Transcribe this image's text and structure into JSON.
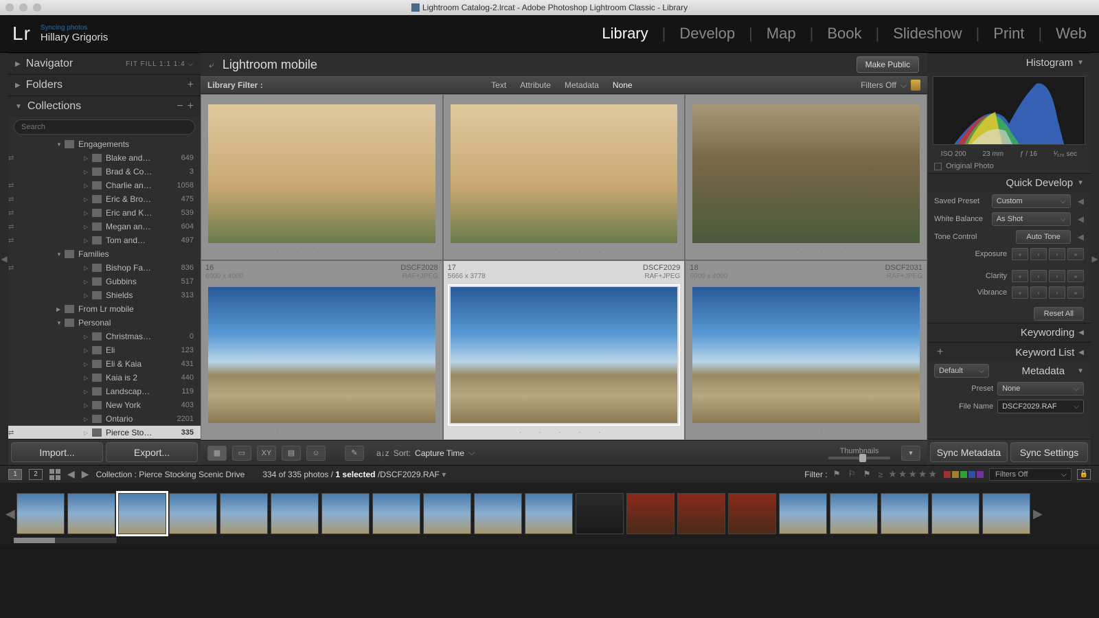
{
  "titlebar": {
    "text": "Lightroom Catalog-2.lrcat - Adobe Photoshop Lightroom Classic - Library"
  },
  "identity": {
    "sync": "Syncing photos",
    "user": "Hillary Grigoris"
  },
  "modules": {
    "library": "Library",
    "develop": "Develop",
    "map": "Map",
    "book": "Book",
    "slideshow": "Slideshow",
    "print": "Print",
    "web": "Web"
  },
  "left": {
    "navigator": {
      "title": "Navigator",
      "modes": "FIT   FILL   1:1   1:4 ⌵"
    },
    "folders": {
      "title": "Folders"
    },
    "collections": {
      "title": "Collections",
      "search_placeholder": "Search"
    },
    "groups": {
      "engagements": "Engagements",
      "families": "Families",
      "fromlr": "From Lr mobile",
      "personal": "Personal"
    },
    "items_eng": [
      {
        "label": "Blake and…",
        "count": "649"
      },
      {
        "label": "Brad & Co…",
        "count": "3"
      },
      {
        "label": "Charlie an…",
        "count": "1058"
      },
      {
        "label": "Eric & Bro…",
        "count": "475"
      },
      {
        "label": "Eric and K…",
        "count": "539"
      },
      {
        "label": "Megan an…",
        "count": "604"
      },
      {
        "label": "Tom and…",
        "count": "497"
      }
    ],
    "items_fam": [
      {
        "label": "Bishop Fa…",
        "count": "836"
      },
      {
        "label": "Gubbins",
        "count": "517"
      },
      {
        "label": "Shields",
        "count": "313"
      }
    ],
    "items_pers": [
      {
        "label": "Christmas…",
        "count": "0"
      },
      {
        "label": "Eli",
        "count": "123"
      },
      {
        "label": "Eli & Kaia",
        "count": "431"
      },
      {
        "label": "Kaia is 2",
        "count": "440"
      },
      {
        "label": "Landscap…",
        "count": "119"
      },
      {
        "label": "New York",
        "count": "403"
      },
      {
        "label": "Ontario",
        "count": "2201"
      },
      {
        "label": "Pierce Sto…",
        "count": "335"
      }
    ],
    "import_btn": "Import...",
    "export_btn": "Export..."
  },
  "center": {
    "breadcrumb": "Lightroom mobile",
    "make_public": "Make Public",
    "filter_label": "Library Filter :",
    "filter_tabs": {
      "text": "Text",
      "attribute": "Attribute",
      "metadata": "Metadata",
      "none": "None"
    },
    "filters_off": "Filters Off",
    "cells": [
      {
        "idx": "16",
        "file": "DSCF2028",
        "dim": "6000 x 4000",
        "fmt": "RAF+JPEG"
      },
      {
        "idx": "17",
        "file": "DSCF2029",
        "dim": "5666 x 3778",
        "fmt": "RAF+JPEG"
      },
      {
        "idx": "18",
        "file": "DSCF2031",
        "dim": "6000 x 4000",
        "fmt": "RAF+JPEG"
      }
    ],
    "sort_label": "Sort:",
    "sort_value": "Capture Time",
    "thumbnails": "Thumbnails"
  },
  "right": {
    "histogram": "Histogram",
    "meta": {
      "iso": "ISO 200",
      "focal": "23 mm",
      "aperture": "ƒ / 16",
      "shutter": "¹⁄₁₇₀ sec"
    },
    "original": "Original Photo",
    "quickdev": "Quick Develop",
    "saved_preset_lbl": "Saved Preset",
    "saved_preset_val": "Custom",
    "wb_lbl": "White Balance",
    "wb_val": "As Shot",
    "tone_lbl": "Tone Control",
    "auto_tone": "Auto Tone",
    "exposure": "Exposure",
    "clarity": "Clarity",
    "vibrance": "Vibrance",
    "reset": "Reset All",
    "keywording": "Keywording",
    "keyword_list": "Keyword List",
    "metadata": "Metadata",
    "default": "Default",
    "preset_lbl": "Preset",
    "preset_val": "None",
    "filename_lbl": "File Name",
    "filename_val": "DSCF2029.RAF",
    "sync_meta": "Sync Metadata",
    "sync_settings": "Sync Settings"
  },
  "status": {
    "collection": "Collection : Pierce Stocking Scenic Drive",
    "counts_a": "334 of 335 photos /",
    "counts_b": "1 selected",
    "counts_c": "/DSCF2029.RAF",
    "filter_lbl": "Filter :",
    "filters_off": "Filters Off"
  }
}
